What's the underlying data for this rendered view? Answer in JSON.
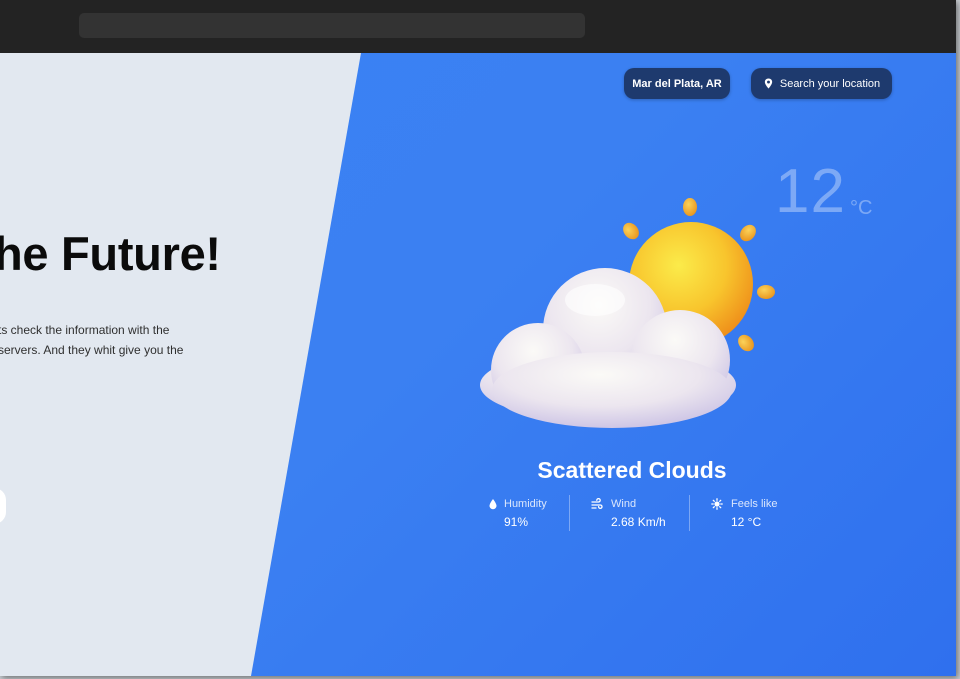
{
  "hero": {
    "headline": "he Future!",
    "description_line1": "ts check the information with the",
    "description_line2": "servers. And they whit give you the"
  },
  "header": {
    "location_label": "Mar del Plata, AR",
    "search_label": "Search your location"
  },
  "weather": {
    "temperature": "12",
    "temperature_unit": "°C",
    "condition": "Scattered Clouds",
    "stats": [
      {
        "label": "Humidity",
        "value": "91%",
        "icon": "humidity-drop-icon"
      },
      {
        "label": "Wind",
        "value": "2.68 Km/h",
        "icon": "wind-icon"
      },
      {
        "label": "Feels like",
        "value": "12 °C",
        "icon": "feels-like-sun-icon"
      }
    ]
  },
  "colors": {
    "panel_blue": "#3a82f4",
    "pill_navy": "#1e3a6e",
    "left_bg": "#e2e8f0",
    "browser_bar": "#232323"
  }
}
